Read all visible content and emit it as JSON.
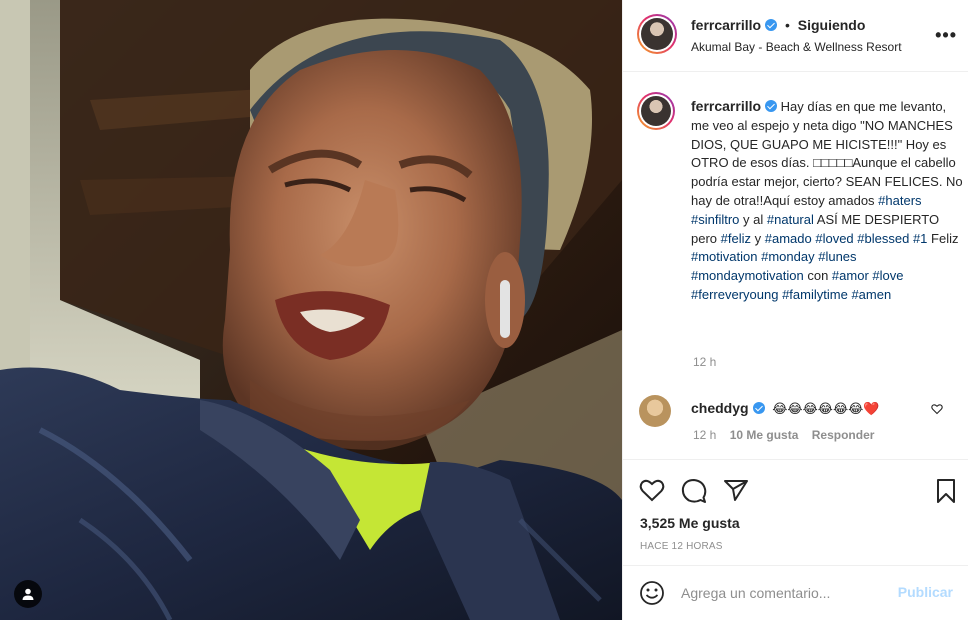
{
  "post": {
    "username": "ferrcarrillo",
    "separator": "•",
    "follow_label": "Siguiendo",
    "location": "Akumal Bay - Beach & Wellness Resort",
    "more_label": "•••"
  },
  "caption": {
    "username": "ferrcarrillo",
    "parts": [
      {
        "text": "Hay días en que me levanto, me veo al espejo y neta digo \"NO MANCHES DIOS, QUE GUAPO ME HICISTE!!!\" Hoy es OTRO de esos días. □□□□□Aunque el cabello podría estar mejor, cierto? SEAN FELICES. No hay de otra!!Aquí estoy amados ",
        "tag": false
      },
      {
        "text": "#haters",
        "tag": true
      },
      {
        "text": " ",
        "tag": false
      },
      {
        "text": "#sinfiltro",
        "tag": true
      },
      {
        "text": " y al ",
        "tag": false
      },
      {
        "text": "#natural",
        "tag": true
      },
      {
        "text": " ASÍ ME DESPIERTO pero ",
        "tag": false
      },
      {
        "text": "#feliz",
        "tag": true
      },
      {
        "text": " y ",
        "tag": false
      },
      {
        "text": "#amado",
        "tag": true
      },
      {
        "text": " ",
        "tag": false
      },
      {
        "text": "#loved",
        "tag": true
      },
      {
        "text": " ",
        "tag": false
      },
      {
        "text": "#blessed",
        "tag": true
      },
      {
        "text": " ",
        "tag": false
      },
      {
        "text": "#1",
        "tag": true
      },
      {
        "text": " Feliz ",
        "tag": false
      },
      {
        "text": "#motivation",
        "tag": true
      },
      {
        "text": " ",
        "tag": false
      },
      {
        "text": "#monday",
        "tag": true
      },
      {
        "text": " ",
        "tag": false
      },
      {
        "text": "#lunes",
        "tag": true
      },
      {
        "text": " ",
        "tag": false
      },
      {
        "text": "#mondaymotivation",
        "tag": true
      },
      {
        "text": " con ",
        "tag": false
      },
      {
        "text": "#amor",
        "tag": true
      },
      {
        "text": " ",
        "tag": false
      },
      {
        "text": "#love",
        "tag": true
      },
      {
        "text": " ",
        "tag": false
      },
      {
        "text": "#ferreveryoung",
        "tag": true
      },
      {
        "text": " ",
        "tag": false
      },
      {
        "text": "#familytime",
        "tag": true
      },
      {
        "text": " ",
        "tag": false
      },
      {
        "text": "#amen",
        "tag": true
      }
    ],
    "time": "12 h"
  },
  "comment": {
    "username": "cheddyg",
    "text": "😂😂😂😂😂😂❤️",
    "time": "12 h",
    "likes": "10 Me gusta",
    "reply_label": "Responder"
  },
  "stats": {
    "likes": "3,525 Me gusta",
    "posted": "HACE 12 HORAS"
  },
  "comment_box": {
    "placeholder": "Agrega un comentario...",
    "publish_label": "Publicar"
  },
  "icons": {
    "like": "heart-icon",
    "comment": "comment-bubble-icon",
    "share": "paper-plane-icon",
    "save": "bookmark-icon",
    "emoji": "smiley-icon",
    "tag": "user-tag-icon"
  },
  "colors": {
    "link": "#00376b",
    "verified": "#3897f0",
    "publish_disabled": "#b3dbff",
    "muted": "#8e8e8e"
  }
}
